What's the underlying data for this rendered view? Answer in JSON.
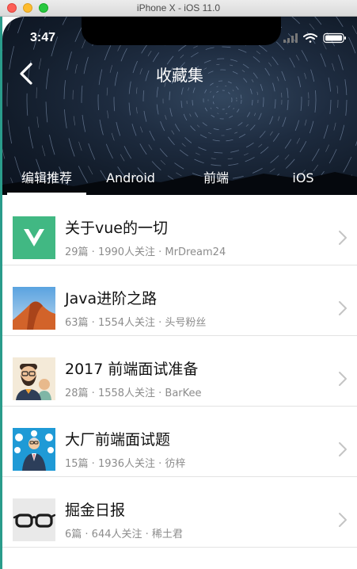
{
  "window": {
    "title": "iPhone X - iOS 11.0"
  },
  "status_bar": {
    "time": "3:47"
  },
  "header": {
    "title": "收藏集",
    "back_icon": "back-chevron-icon"
  },
  "tabs": [
    {
      "label": "编辑推荐",
      "active": true
    },
    {
      "label": "Android",
      "active": false
    },
    {
      "label": "前端",
      "active": false
    },
    {
      "label": "iOS",
      "active": false
    }
  ],
  "collections": [
    {
      "title": "关于vue的一切",
      "meta": "29篇 · 1990人关注 · MrDream24",
      "thumb": "vue-logo"
    },
    {
      "title": "Java进阶之路",
      "meta": "63篇 · 1554人关注 · 头号粉丝",
      "thumb": "desert-dune"
    },
    {
      "title": "2017 前端面试准备",
      "meta": "28篇 · 1558人关注 · BarKee",
      "thumb": "bearded-man"
    },
    {
      "title": "大厂前端面试题",
      "meta": "15篇 · 1936人关注 · 彷梓",
      "thumb": "speaker-bubbles"
    },
    {
      "title": "掘金日报",
      "meta": "6篇 · 644人关注 · 稀土君",
      "thumb": "glasses"
    }
  ],
  "colors": {
    "frame": "#2a9c8b",
    "vue_green": "#41b883"
  }
}
